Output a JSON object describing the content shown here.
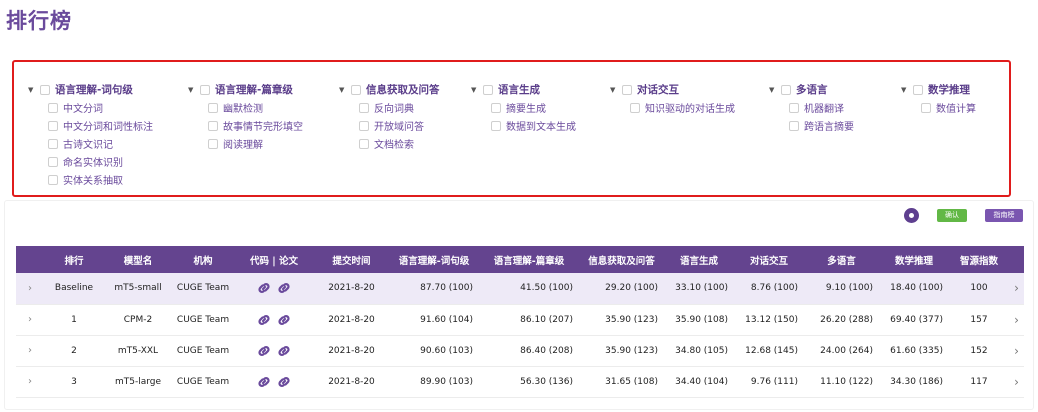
{
  "page": {
    "title": "排行榜"
  },
  "filters": [
    {
      "label": "语言理解-词句级",
      "items": [
        "中文分词",
        "中文分词和词性标注",
        "古诗文识记",
        "命名实体识别",
        "实体关系抽取"
      ]
    },
    {
      "label": "语言理解-篇章级",
      "items": [
        "幽默检测",
        "故事情节完形填空",
        "阅读理解"
      ]
    },
    {
      "label": "信息获取及问答",
      "items": [
        "反向词典",
        "开放域问答",
        "文档检索"
      ]
    },
    {
      "label": "语言生成",
      "items": [
        "摘要生成",
        "数据到文本生成"
      ]
    },
    {
      "label": "对话交互",
      "items": [
        "知识驱动的对话生成"
      ]
    },
    {
      "label": "多语言",
      "items": [
        "机器翻译",
        "跨语言摘要"
      ]
    },
    {
      "label": "数学推理",
      "items": [
        "数值计算"
      ]
    }
  ],
  "controls": {
    "confirm_label": "确认",
    "leaderboard_label": "指南榜"
  },
  "table": {
    "headers": [
      "排行",
      "模型名",
      "机构",
      "代码 | 论文",
      "提交时间",
      "语言理解-词句级",
      "语言理解-篇章级",
      "信息获取及问答",
      "语言生成",
      "对话交互",
      "多语言",
      "数学推理",
      "智源指数"
    ],
    "rows": [
      {
        "rank": "Baseline",
        "model": "mT5-small",
        "org": "CUGE Team",
        "date": "2021-8-20",
        "s1": "87.70 (100)",
        "s2": "41.50 (100)",
        "s3": "29.20 (100)",
        "s4": "33.10 (100)",
        "s5": "8.76 (100)",
        "s6": "9.10 (100)",
        "s7": "18.40 (100)",
        "index": "100"
      },
      {
        "rank": "1",
        "model": "CPM-2",
        "org": "CUGE Team",
        "date": "2021-8-20",
        "s1": "91.60 (104)",
        "s2": "86.10 (207)",
        "s3": "35.90 (123)",
        "s4": "35.90 (108)",
        "s5": "13.12 (150)",
        "s6": "26.20 (288)",
        "s7": "69.40 (377)",
        "index": "157"
      },
      {
        "rank": "2",
        "model": "mT5-XXL",
        "org": "CUGE Team",
        "date": "2021-8-20",
        "s1": "90.60 (103)",
        "s2": "86.40 (208)",
        "s3": "35.90 (123)",
        "s4": "34.80 (105)",
        "s5": "12.68 (145)",
        "s6": "24.00 (264)",
        "s7": "61.60 (335)",
        "index": "152"
      },
      {
        "rank": "3",
        "model": "mT5-large",
        "org": "CUGE Team",
        "date": "2021-8-20",
        "s1": "89.90 (103)",
        "s2": "56.30 (136)",
        "s3": "31.65 (108)",
        "s4": "34.40 (104)",
        "s5": "9.76 (111)",
        "s6": "11.10 (122)",
        "s7": "34.30 (186)",
        "index": "117"
      }
    ]
  },
  "colors": {
    "accent": "#64448f",
    "highlight_border": "#e01c1c",
    "confirm": "#62b846",
    "baseline_row": "#eeeaf7"
  },
  "icons": {
    "expand": "chevron-right-icon",
    "caret": "caret-down-icon",
    "link": "link-icon"
  }
}
